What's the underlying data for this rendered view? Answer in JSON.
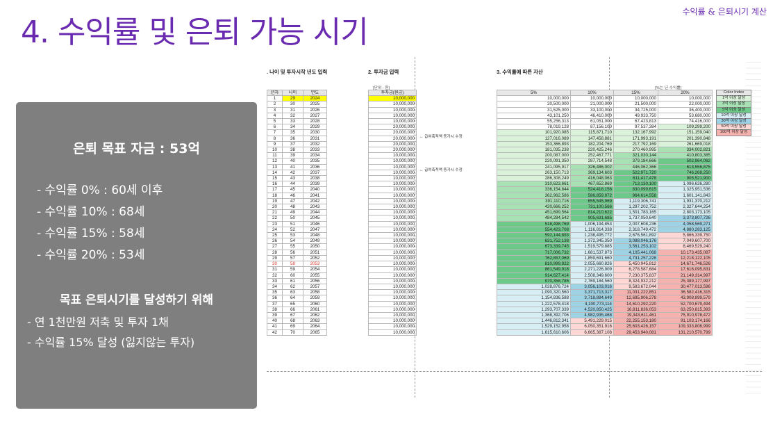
{
  "title": "4. 수익률 및 은퇴 가능 시기",
  "top_right": "수익률 & 은퇴시기 계산",
  "summary": {
    "goal": "은퇴 목표 자금 : 53억",
    "rates": [
      "- 수익률    0% : 60세 이후",
      "- 수익률 10% : 68세",
      "- 수익률 15% : 58세",
      "- 수익률 20% : 53세"
    ],
    "subtitle": "목표 은퇴시기를 달성하기 위해",
    "bullets": [
      "- 연 1천만원 저축 및 투자 1채",
      "- 수익률 15% 달성 (잃지않는 투자)"
    ]
  },
  "sheet": {
    "sec1": ". 나이 및 투자시작 년도 입력",
    "sec2": "2. 투자금 입력",
    "sec3": "3. 수익률에 따른 자산",
    "unit_left": "[단위 : 원]",
    "unit_right": "[%는 년 수익률]",
    "headers_a": [
      "년차",
      "나이",
      "연도"
    ],
    "header_b": "투자금(원금)",
    "headers_c": [
      "5%",
      "10%",
      "15%",
      "20%"
    ],
    "note1": "← 급여축적액 증가시 수정",
    "note2": "← 급여축적액 증가시 수정",
    "legend_title": "Color Index",
    "legend": [
      {
        "label": "1억 이상 달성",
        "color": "#d9f2d9"
      },
      {
        "label": "3억 이상 달성",
        "color": "#a8e2b4"
      },
      {
        "label": "5억 이상 달성",
        "color": "#6cc98a"
      },
      {
        "label": "10억 이상 달성",
        "color": "#d7eef5"
      },
      {
        "label": "30억 이상 달성",
        "color": "#9ed3e6"
      },
      {
        "label": "50억 이상 달성",
        "color": "#ffd8d6"
      },
      {
        "label": "100억 이상 달성",
        "color": "#f6b2ae"
      }
    ],
    "rows": [
      [
        "1",
        "29",
        "2024",
        "10,000,000",
        "10,000,000",
        "10,000,000",
        "10,000,000",
        "10,000,000"
      ],
      [
        "2",
        "30",
        "2025",
        "10,000,000",
        "20,500,000",
        "21,000,000",
        "21,500,000",
        "22,000,000"
      ],
      [
        "3",
        "31",
        "2026",
        "10,000,000",
        "31,525,000",
        "33,100,000",
        "34,725,000",
        "36,400,000"
      ],
      [
        "4",
        "32",
        "2027",
        "10,000,000",
        "43,101,250",
        "46,410,000",
        "49,933,750",
        "53,680,000"
      ],
      [
        "5",
        "33",
        "2028",
        "10,000,000",
        "55,256,313",
        "61,051,000",
        "67,423,813",
        "74,416,000"
      ],
      [
        "6",
        "34",
        "2029",
        "20,000,000",
        "78,019,128",
        "87,156,100",
        "97,537,384",
        "109,299,200"
      ],
      [
        "7",
        "35",
        "2030",
        "20,000,000",
        "101,920,085",
        "115,871,710",
        "132,167,992",
        "151,159,040"
      ],
      [
        "8",
        "36",
        "2031",
        "20,000,000",
        "127,016,089",
        "147,458,881",
        "171,993,191",
        "201,390,848"
      ],
      [
        "9",
        "37",
        "2032",
        "20,000,000",
        "153,366,893",
        "182,204,769",
        "217,792,169",
        "261,669,018"
      ],
      [
        "10",
        "38",
        "2033",
        "20,000,000",
        "181,035,238",
        "220,425,246",
        "270,460,995",
        "334,002,821"
      ],
      [
        "11",
        "39",
        "2034",
        "10,000,000",
        "200,087,000",
        "252,467,771",
        "321,030,144",
        "410,803,385"
      ],
      [
        "12",
        "40",
        "2035",
        "10,000,000",
        "220,091,350",
        "287,714,548",
        "379,184,666",
        "502,964,062"
      ],
      [
        "13",
        "41",
        "2036",
        "10,000,000",
        "241,095,917",
        "326,486,002",
        "446,062,366",
        "613,556,875"
      ],
      [
        "14",
        "42",
        "2037",
        "10,000,000",
        "263,150,713",
        "369,134,603",
        "522,971,720",
        "746,268,250"
      ],
      [
        "15",
        "43",
        "2038",
        "10,000,000",
        "286,308,249",
        "416,048,063",
        "611,417,478",
        "905,521,900"
      ],
      [
        "16",
        "44",
        "2039",
        "10,000,000",
        "310,623,661",
        "467,652,869",
        "713,130,100",
        "1,096,626,280"
      ],
      [
        "17",
        "45",
        "2040",
        "10,000,000",
        "336,154,844",
        "524,418,156",
        "830,099,615",
        "1,325,951,536"
      ],
      [
        "18",
        "46",
        "2041",
        "10,000,000",
        "362,962,586",
        "586,859,972",
        "964,614,558",
        "1,601,141,843"
      ],
      [
        "19",
        "47",
        "2042",
        "10,000,000",
        "391,110,716",
        "655,545,969",
        "1,119,306,741",
        "1,931,370,212"
      ],
      [
        "20",
        "48",
        "2043",
        "10,000,000",
        "420,666,252",
        "731,100,566",
        "1,297,202,752",
        "2,327,644,254"
      ],
      [
        "21",
        "49",
        "2044",
        "10,000,000",
        "451,699,564",
        "814,210,622",
        "1,501,783,165",
        "2,803,173,105"
      ],
      [
        "22",
        "50",
        "2045",
        "10,000,000",
        "484,284,542",
        "905,631,685",
        "1,737,050,640",
        "3,373,807,726"
      ],
      [
        "23",
        "51",
        "2046",
        "10,000,000",
        "518,498,769",
        "1,006,194,853",
        "2,007,608,236",
        "4,058,569,271"
      ],
      [
        "24",
        "52",
        "2047",
        "10,000,000",
        "554,423,708",
        "1,116,814,338",
        "2,318,749,472",
        "4,880,283,125"
      ],
      [
        "25",
        "53",
        "2048",
        "10,000,000",
        "592,144,893",
        "1,238,495,772",
        "2,676,561,892",
        "5,866,339,750"
      ],
      [
        "26",
        "54",
        "2049",
        "10,000,000",
        "631,752,138",
        "1,372,345,350",
        "3,088,046,176",
        "7,049,607,700"
      ],
      [
        "27",
        "55",
        "2050",
        "10,000,000",
        "673,339,745",
        "1,519,579,885",
        "3,561,253,102",
        "8,469,529,240"
      ],
      [
        "28",
        "56",
        "2051",
        "10,000,000",
        "717,006,732",
        "1,681,537,873",
        "4,105,441,068",
        "10,173,435,087"
      ],
      [
        "29",
        "57",
        "2052",
        "10,000,000",
        "762,857,069",
        "1,859,691,660",
        "4,731,257,228",
        "12,218,122,105"
      ],
      [
        "30",
        "58",
        "2053",
        "10,000,000",
        "810,999,922",
        "2,055,660,826",
        "5,450,945,812",
        "14,671,746,526"
      ],
      [
        "31",
        "59",
        "2054",
        "10,000,000",
        "861,549,918",
        "2,271,226,909",
        "6,278,587,684",
        "17,616,095,831"
      ],
      [
        "32",
        "60",
        "2055",
        "10,000,000",
        "914,627,414",
        "2,508,349,600",
        "7,230,375,837",
        "21,149,314,997"
      ],
      [
        "33",
        "61",
        "2056",
        "10,000,000",
        "970,358,785",
        "2,769,184,560",
        "8,324,932,212",
        "25,389,177,997"
      ],
      [
        "34",
        "62",
        "2057",
        "10,000,000",
        "1,028,876,724",
        "3,056,103,016",
        "9,583,672,044",
        "30,477,013,596"
      ],
      [
        "35",
        "63",
        "2058",
        "10,000,000",
        "1,090,320,560",
        "3,371,713,317",
        "11,031,222,851",
        "36,582,416,315"
      ],
      [
        "36",
        "64",
        "2059",
        "10,000,000",
        "1,154,836,588",
        "3,718,884,649",
        "12,695,906,278",
        "43,908,899,579"
      ],
      [
        "37",
        "65",
        "2060",
        "10,000,000",
        "1,222,578,418",
        "4,100,773,114",
        "14,610,292,220",
        "52,700,679,494"
      ],
      [
        "38",
        "66",
        "2061",
        "10,000,000",
        "1,293,707,339",
        "4,520,850,425",
        "16,811,836,053",
        "63,250,815,393"
      ],
      [
        "39",
        "67",
        "2062",
        "10,000,000",
        "1,368,392,706",
        "4,982,935,468",
        "19,343,611,461",
        "75,910,978,472"
      ],
      [
        "40",
        "68",
        "2063",
        "10,000,000",
        "1,446,812,341",
        "5,491,229,015",
        "22,255,153,180",
        "91,103,174,166"
      ],
      [
        "41",
        "69",
        "2064",
        "10,000,000",
        "1,529,152,958",
        "6,050,351,916",
        "25,603,426,157",
        "109,333,808,999"
      ],
      [
        "42",
        "70",
        "2065",
        "10,000,000",
        "1,615,610,606",
        "6,665,387,108",
        "29,453,940,081",
        "131,210,570,799"
      ]
    ]
  }
}
